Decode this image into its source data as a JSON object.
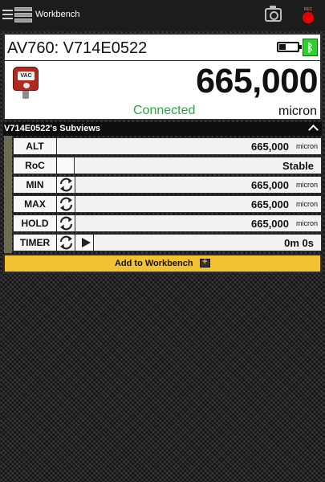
{
  "appbar": {
    "title": "Workbench"
  },
  "device": {
    "name": "AV760: V714E0522",
    "vac_label": "VAC",
    "reading": "665,000",
    "status": "Connected",
    "unit": "micron",
    "battery_level": 0.35,
    "bluetooth_glyph": "ᛒ"
  },
  "subviews": {
    "title": "V714E0522's Subviews",
    "rows": [
      {
        "label": "ALT",
        "value": "665,000",
        "unit": "micron"
      },
      {
        "label": "RoC",
        "value": "Stable",
        "unit": ""
      },
      {
        "label": "MIN",
        "value": "665,000",
        "unit": "micron"
      },
      {
        "label": "MAX",
        "value": "665,000",
        "unit": "micron"
      },
      {
        "label": "HOLD",
        "value": "665,000",
        "unit": "micron"
      },
      {
        "label": "TIMER",
        "value": "0m 0s",
        "unit": ""
      }
    ]
  },
  "add_button": {
    "label": "Add to Workbench"
  },
  "colors": {
    "accent": "#f3c233",
    "connected": "#2aa940",
    "bluetooth": "#2fd12f",
    "record": "#e60000"
  },
  "icons": [
    "menu-icon",
    "workbench-icon",
    "camera-icon",
    "record-icon",
    "battery-icon",
    "bluetooth-icon",
    "vac-gauge-icon",
    "chevron-up-icon",
    "reset-icon",
    "play-icon",
    "add-to-workbench-icon"
  ]
}
